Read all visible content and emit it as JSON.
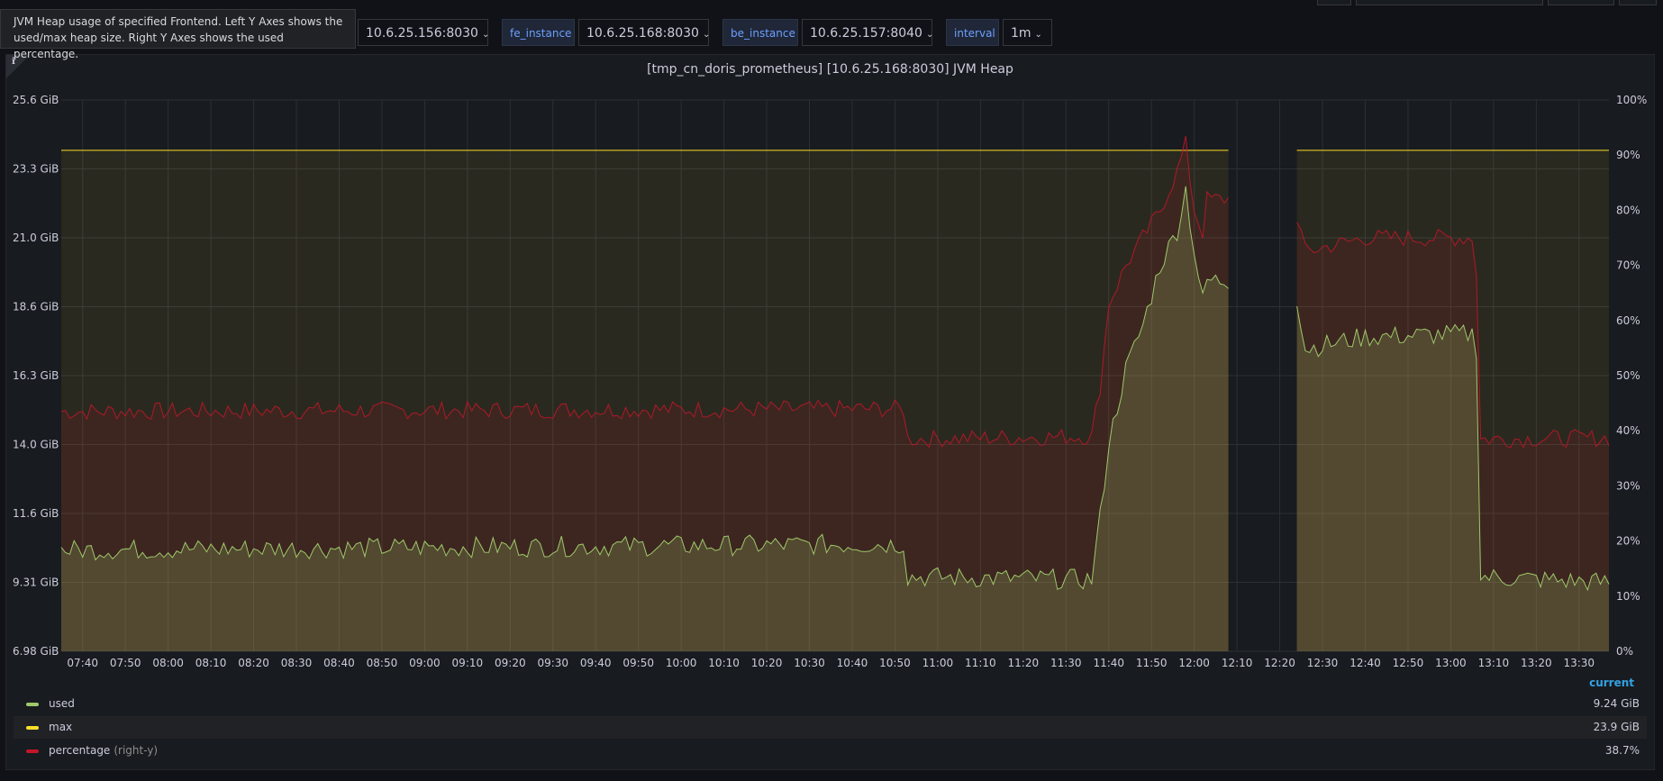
{
  "tooltip": {
    "text": "JVM Heap usage of specified Frontend. Left Y Axes shows the used/max heap size. Right Y Axes shows the used percentage."
  },
  "variables": [
    {
      "value": "10.6.25.156:8030"
    },
    {
      "label": "fe_instance",
      "value": "10.6.25.168:8030"
    },
    {
      "label": "be_instance",
      "value": "10.6.25.157:8040"
    },
    {
      "label": "interval",
      "value": "1m"
    }
  ],
  "panel": {
    "title": "[tmp_cn_doris_prometheus] [10.6.25.168:8030] JVM Heap",
    "info_icon": "info-icon"
  },
  "legend": {
    "header": "current",
    "items": [
      {
        "name": "used",
        "axis_note": "",
        "value": "9.24 GiB",
        "color": "#9fc86a"
      },
      {
        "name": "max",
        "axis_note": "",
        "value": "23.9 GiB",
        "color": "#fade2a"
      },
      {
        "name": "percentage",
        "axis_note": "(right-y)",
        "value": "38.7%",
        "color": "#c4162a"
      }
    ]
  },
  "chart_data": {
    "type": "line",
    "title": "[tmp_cn_doris_prometheus] [10.6.25.168:8030] JVM Heap",
    "x_start": "07:35",
    "x_end": "13:37",
    "x_ticks": [
      "07:40",
      "07:50",
      "08:00",
      "08:10",
      "08:20",
      "08:30",
      "08:40",
      "08:50",
      "09:00",
      "09:10",
      "09:20",
      "09:30",
      "09:40",
      "09:50",
      "10:00",
      "10:10",
      "10:20",
      "10:30",
      "10:40",
      "10:50",
      "11:00",
      "11:10",
      "11:20",
      "11:30",
      "11:40",
      "11:50",
      "12:00",
      "12:10",
      "12:20",
      "12:30",
      "12:40",
      "12:50",
      "13:00",
      "13:10",
      "13:20",
      "13:30"
    ],
    "y_left": {
      "unit": "GiB",
      "ticks": [
        "6.98 GiB",
        "9.31 GiB",
        "11.6 GiB",
        "14.0 GiB",
        "16.3 GiB",
        "18.6 GiB",
        "21.0 GiB",
        "23.3 GiB",
        "25.6 GiB"
      ],
      "range": [
        6.98,
        25.6
      ]
    },
    "y_right": {
      "unit": "%",
      "ticks": [
        "0%",
        "10%",
        "20%",
        "30%",
        "40%",
        "50%",
        "60%",
        "70%",
        "80%",
        "90%",
        "100%"
      ],
      "range": [
        0,
        100
      ]
    },
    "gap": [
      "12:08",
      "12:24"
    ],
    "series": [
      {
        "name": "used",
        "axis": "left",
        "color": "#9fc86a",
        "segments": [
          [
            [
              "07:35",
              10.4
            ],
            [
              "10:52",
              10.6
            ],
            [
              "10:53",
              9.5
            ],
            [
              "11:36",
              9.4
            ],
            [
              "11:38",
              11.5
            ],
            [
              "11:40",
              14.0
            ],
            [
              "11:44",
              16.5
            ],
            [
              "11:48",
              18.0
            ],
            [
              "11:52",
              20.0
            ],
            [
              "11:56",
              21.2
            ],
            [
              "11:58",
              22.6
            ],
            [
              "12:00",
              20.5
            ],
            [
              "12:02",
              18.8
            ],
            [
              "12:03",
              19.5
            ],
            [
              "12:08",
              19.5
            ]
          ],
          [
            [
              "12:24",
              18.9
            ],
            [
              "12:26",
              17.2
            ],
            [
              "12:40",
              17.6
            ],
            [
              "13:05",
              17.7
            ],
            [
              "13:06",
              17.2
            ],
            [
              "13:07",
              9.5
            ],
            [
              "13:37",
              9.3
            ]
          ]
        ]
      },
      {
        "name": "max",
        "axis": "left",
        "color": "#fade2a",
        "segments": [
          [
            [
              "07:35",
              23.9
            ],
            [
              "12:08",
              23.9
            ]
          ],
          [
            [
              "12:24",
              23.9
            ],
            [
              "13:37",
              23.9
            ]
          ]
        ]
      },
      {
        "name": "percentage",
        "axis": "right",
        "color": "#c4162a",
        "segments": [
          [
            [
              "07:35",
              43.5
            ],
            [
              "10:52",
              44.0
            ],
            [
              "10:53",
              38.5
            ],
            [
              "11:36",
              39.0
            ],
            [
              "11:38",
              48.0
            ],
            [
              "11:40",
              63.0
            ],
            [
              "11:44",
              70.0
            ],
            [
              "11:48",
              75.0
            ],
            [
              "11:52",
              80.0
            ],
            [
              "11:56",
              87.0
            ],
            [
              "11:58",
              92.0
            ],
            [
              "12:00",
              80.0
            ],
            [
              "12:02",
              76.0
            ],
            [
              "12:03",
              82.0
            ],
            [
              "12:08",
              82.0
            ]
          ],
          [
            [
              "12:24",
              79.0
            ],
            [
              "12:26",
              72.5
            ],
            [
              "12:40",
              75.0
            ],
            [
              "13:05",
              75.0
            ],
            [
              "13:06",
              69.0
            ],
            [
              "13:07",
              38.5
            ],
            [
              "13:37",
              38.7
            ]
          ]
        ]
      }
    ]
  }
}
